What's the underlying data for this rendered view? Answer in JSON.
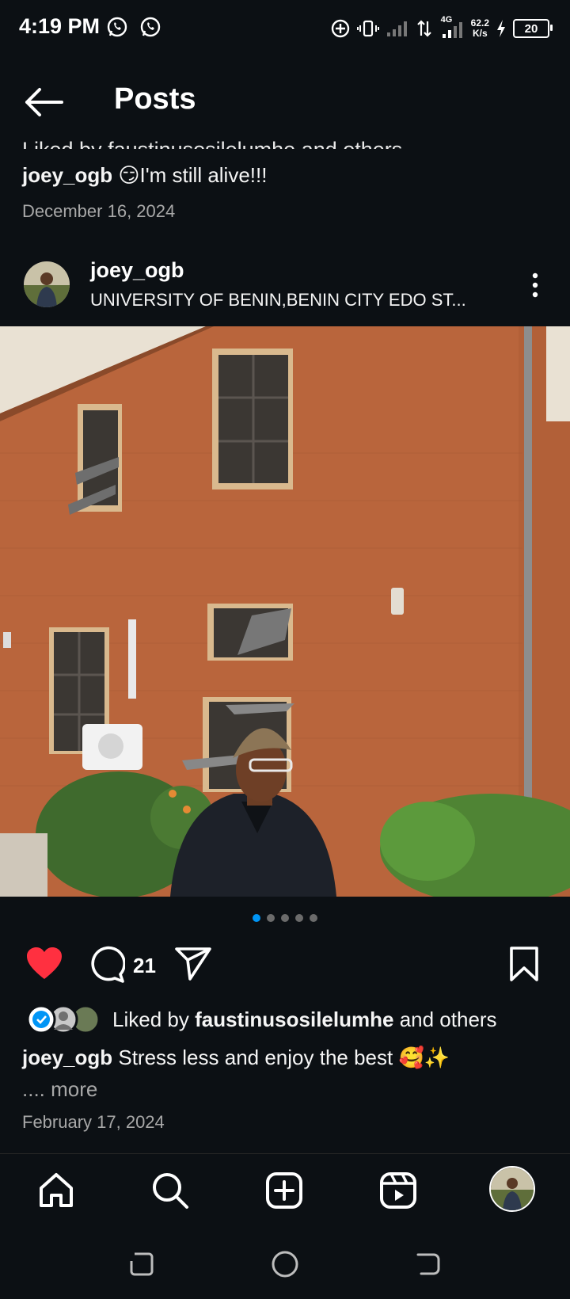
{
  "status_bar": {
    "time": "4:19 PM",
    "network_speed_value": "62.2",
    "network_speed_unit": "K/s",
    "network_type": "4G",
    "battery": "20",
    "icons": [
      "whatsapp-icon",
      "whatsapp-icon",
      "location-add-icon",
      "vibrate-icon",
      "signal-icon",
      "data-transfer-icon",
      "signal-icon",
      "charging-icon",
      "battery-icon"
    ]
  },
  "header": {
    "title": "Posts"
  },
  "previous_post": {
    "liked_by_partial": "Liked by faustinusosilelumhe and others",
    "caption_user": "joey_ogb",
    "caption_text": "😏I'm still alive!!!",
    "date": "December 16, 2024"
  },
  "post": {
    "username": "joey_ogb",
    "location": "UNIVERSITY OF BENIN,BENIN CITY EDO ST...",
    "carousel": {
      "count": 5,
      "active": 1
    },
    "comment_count": "21",
    "liked": true,
    "liked_by_prefix": "Liked by ",
    "liked_by_user": "faustinusosilelumhe",
    "liked_by_suffix": " and others",
    "caption_user": "joey_ogb",
    "caption_text": " Stress less and enjoy the best 🥰✨",
    "more_label": ".... more",
    "date": "February 17, 2024"
  },
  "colors": {
    "background": "#0c1014",
    "like_red": "#ff3040",
    "accent_blue": "#0095f6",
    "muted_text": "#a8a8a8",
    "wall_brick": "#b9653c"
  },
  "bottom_nav": {
    "items": [
      "home-icon",
      "search-icon",
      "create-icon",
      "reels-icon",
      "profile-avatar"
    ]
  },
  "system_nav": {
    "items": [
      "recents-icon",
      "home-circle-icon",
      "back-icon"
    ]
  }
}
